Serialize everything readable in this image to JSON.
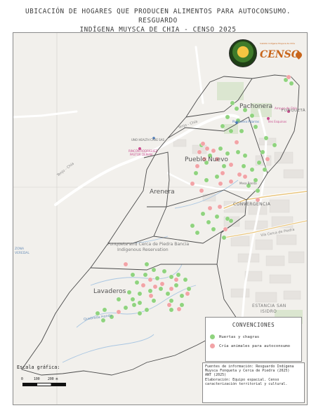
{
  "map": {
    "title_line1": "UBICACIÓN DE HOGARES QUE PRODUCEN ALIMENTOS PARA AUTOCONSUMO. RESGUARDO",
    "title_line2": "INDÍGENA MUYSCA DE CHIA - CENSO 2025",
    "place_labels": {
      "pachonera": "Pachonera",
      "fonqueta": "FONQUETÁ",
      "pueblo_nuevo": "Pueblo Nuevo",
      "arenera": "Arenera",
      "convergencia": "CONVERGENCIA",
      "lavaderos": "Lavaderos",
      "reservation": "Fonqueta and Cerca de Piedra Bancia",
      "reservation_2": "Indigenous Reservation",
      "estancia": "ESTANCIA SAN",
      "estancia_2": "ISIDRO",
      "road_tenjo": "Tenjo - Chía",
      "road_tenjo_2": "Tenjo - Chía",
      "road_cerca": "Vía Cerca de Piedra",
      "road_quebrada": "Quebrada Honda",
      "poi_health": "UNO HEALTH CARE SAS",
      "poi_rincon": "RINCÓN RODRÍGUEZ",
      "poi_rincon_2": "PASTOR DEMAN",
      "poi_pachonera": "Pachonera Pizarras",
      "poi_arroyo": "Arroyos de Chía",
      "poi_tres": "Tres Esquinas",
      "poi_mesa": "Mesa Bonita",
      "left_edge": "ZONA",
      "left_edge_2": "VEREDAL"
    },
    "logo_text": "CENSO",
    "logo_small": "Cabildo Indígena Muysca de Chía"
  },
  "legend": {
    "title": "CONVENCIONES",
    "items": [
      {
        "label": "Huertas y chagras",
        "color": "#8fd37e"
      },
      {
        "label": "Cría animales para autoconsumo",
        "color": "#f2a3a6"
      }
    ]
  },
  "sources": {
    "line1": "Fuentes de información: Resguardo Indígena",
    "line2": "Muysca Fonqueta y Cerca de Piedra (2025)",
    "line3": "ANT (2025)",
    "line4": "Elaboración: Equipo espacial. Censo",
    "line5": "caracterización territorial y cultural."
  },
  "scale": {
    "label": "Escala gráfica:",
    "t0": "0",
    "t1": "100",
    "t2": "200 m"
  }
}
